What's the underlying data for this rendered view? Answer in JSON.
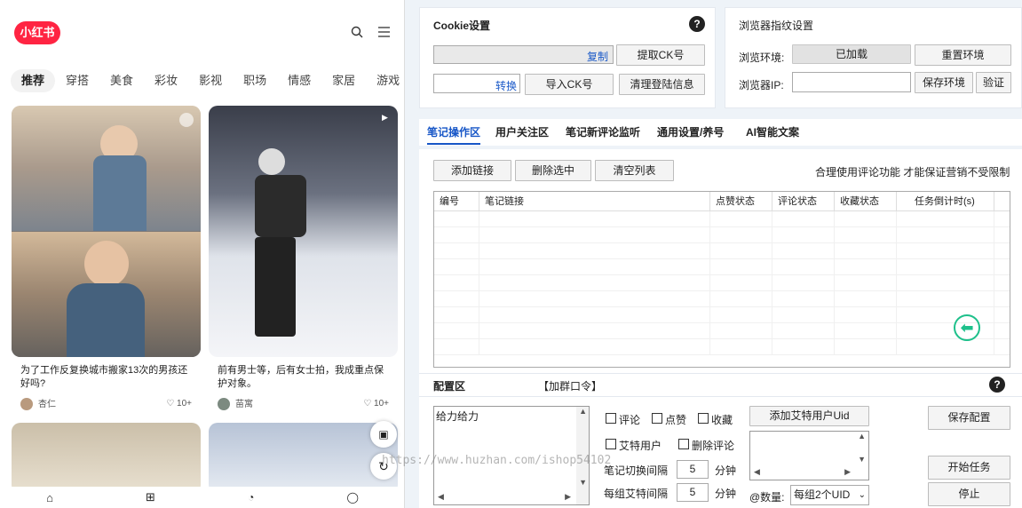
{
  "app": {
    "logo": "小红书"
  },
  "phone": {
    "tabs": [
      "推荐",
      "穿搭",
      "美食",
      "彩妆",
      "影视",
      "职场",
      "情感",
      "家居",
      "游戏"
    ],
    "cards": [
      {
        "title": "为了工作反复换城市搬家13次的男孩还好吗?",
        "author": "杏仁",
        "likes": "10+"
      },
      {
        "title": "前有男士等，后有女士拍，我成重点保护对象。",
        "author": "苗寓",
        "likes": "10+"
      }
    ]
  },
  "cookie": {
    "title": "Cookie设置",
    "copy": "复制",
    "extract_ck": "提取CK号",
    "convert": "转换",
    "import_ck": "导入CK号",
    "clear_login": "清理登陆信息"
  },
  "fingerprint": {
    "title": "浏览器指纹设置",
    "env_label": "浏览环境:",
    "env_value": "已加载",
    "reset_env": "重置环境",
    "ip_label": "浏览器IP:",
    "save_env": "保存环境",
    "verify": "验证"
  },
  "tabs": [
    "笔记操作区",
    "用户关注区",
    "笔记新评论监听",
    "通用设置/养号",
    "AI智能文案"
  ],
  "toolbar": {
    "add_link": "添加链接",
    "delete_selected": "删除选中",
    "clear_list": "清空列表",
    "notice": "合理使用评论功能 才能保证营销不受限制"
  },
  "table": {
    "columns": [
      "编号",
      "笔记链接",
      "点赞状态",
      "评论状态",
      "收藏状态",
      "任务倒计时(s)"
    ]
  },
  "config": {
    "title": "配置区",
    "join_group": "【加群口令】",
    "textarea_value": "给力给力",
    "comment": "评论",
    "like": "点赞",
    "collect": "收藏",
    "mention_user": "艾特用户",
    "delete_comment": "删除评论",
    "add_mention_uid": "添加艾特用户Uid",
    "note_switch_label": "笔记切换间隔",
    "note_switch_value": "5",
    "group_mention_label": "每组艾特间隔",
    "group_mention_value": "5",
    "minute": "分钟",
    "count_label": "@数量:",
    "count_value": "每组2个UID",
    "save_config": "保存配置",
    "start_task": "开始任务",
    "stop": "停止"
  },
  "watermark": "https://www.huzhan.com/ishop54102"
}
